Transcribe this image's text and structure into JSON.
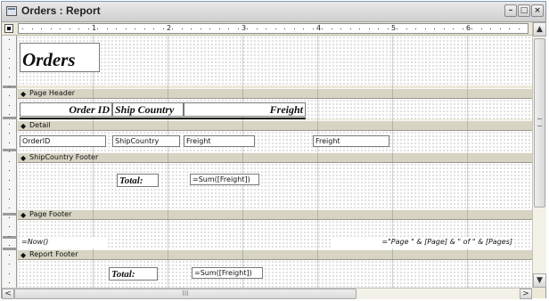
{
  "window": {
    "title": "Orders : Report",
    "buttons": [
      "–",
      "□",
      "×"
    ]
  },
  "ruler": {
    "marks": [
      "1",
      "2",
      "3",
      "4",
      "5",
      "6"
    ]
  },
  "sections": {
    "page_header": "Page Header",
    "detail": "Detail",
    "group_footer": "ShipCountry Footer",
    "page_footer": "Page Footer",
    "report_footer": "Report Footer",
    "arrow": "◆"
  },
  "report_header": {
    "title": "Orders"
  },
  "page_header": {
    "col1": "Order ID",
    "col2": "Ship Country",
    "col3": "Freight"
  },
  "detail": {
    "field1": "OrderID",
    "field2": "ShipCountry",
    "field3": "Freight",
    "field4": "Freight"
  },
  "group_footer": {
    "total_label": "Total:",
    "sum_expr": "=Sum([Freight])"
  },
  "page_footer": {
    "now_expr": "=Now()",
    "page_expr": "=\"Page \" & [Page] & \" of \" & [Pages]"
  },
  "report_footer": {
    "total_label": "Total:",
    "sum_expr": "=Sum([Freight])"
  },
  "scrollbar": {
    "up": "▲",
    "down": "▼",
    "left": "<",
    "right": ">",
    "grip": "III"
  }
}
